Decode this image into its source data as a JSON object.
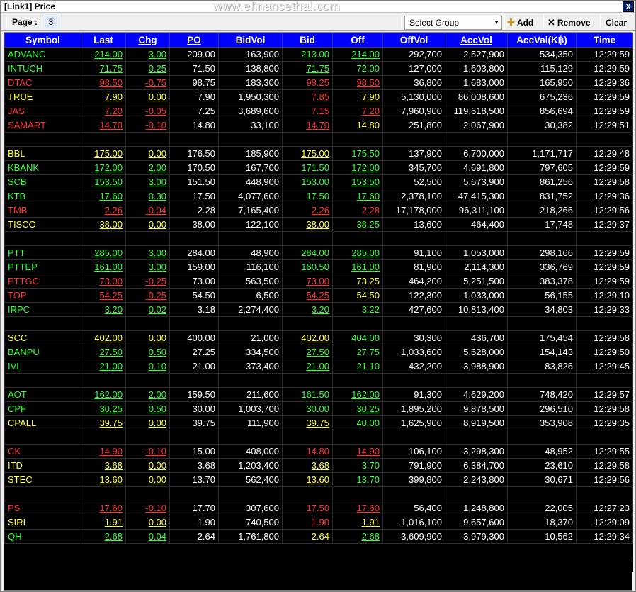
{
  "window": {
    "title": "[Link1] Price",
    "watermark": "www.efinancethai.com",
    "close_label": "X"
  },
  "toolbar": {
    "page_label": "Page :",
    "page_value": "3",
    "group_select": "Select Group",
    "add_label": "Add",
    "remove_label": "Remove",
    "clear_label": "Clear"
  },
  "columns": [
    "Symbol",
    "Last",
    "Chg",
    "PO",
    "BidVol",
    "Bid",
    "Off",
    "OffVol",
    "AccVol",
    "AccVal(K฿)",
    "Time"
  ],
  "colors": {
    "up": "#33ff33",
    "down": "#ff3333",
    "unchanged": "#ffff33",
    "header": "#0000ff"
  },
  "rows": [
    {
      "s": "ADVANC",
      "c": "g",
      "last": "214.00",
      "lc": "g",
      "chg": "3.00",
      "cc": "g",
      "po": "209.00",
      "bidvol": "163,900",
      "bid": "213.00",
      "bc": "g",
      "bu": false,
      "off": "214.00",
      "oc": "g",
      "ou": true,
      "offvol": "292,700",
      "accvol": "2,527,900",
      "accval": "534,350",
      "time": "12:29:59"
    },
    {
      "s": "INTUCH",
      "c": "g",
      "last": "71.75",
      "lc": "g",
      "chg": "0.25",
      "cc": "g",
      "po": "71.50",
      "bidvol": "138,800",
      "bid": "71.75",
      "bc": "g",
      "bu": true,
      "off": "72.00",
      "oc": "g",
      "ou": false,
      "offvol": "127,000",
      "accvol": "1,603,800",
      "accval": "115,129",
      "time": "12:29:59"
    },
    {
      "s": "DTAC",
      "c": "r",
      "last": "98.50",
      "lc": "r",
      "chg": "-0.75",
      "cc": "r",
      "po": "98.75",
      "bidvol": "183,300",
      "bid": "98.25",
      "bc": "r",
      "bu": false,
      "off": "98.50",
      "oc": "r",
      "ou": true,
      "offvol": "36,800",
      "accvol": "1,683,000",
      "accval": "165,950",
      "time": "12:29:36"
    },
    {
      "s": "TRUE",
      "c": "y",
      "last": "7.90",
      "lc": "y",
      "chg": "0.00",
      "cc": "y",
      "po": "7.90",
      "bidvol": "1,950,300",
      "bid": "7.85",
      "bc": "r",
      "bu": false,
      "off": "7.90",
      "oc": "y",
      "ou": true,
      "offvol": "5,130,000",
      "accvol": "86,008,600",
      "accval": "675,236",
      "time": "12:29:59"
    },
    {
      "s": "JAS",
      "c": "r",
      "last": "7.20",
      "lc": "r",
      "chg": "-0.05",
      "cc": "r",
      "po": "7.25",
      "bidvol": "3,689,600",
      "bid": "7.15",
      "bc": "r",
      "bu": false,
      "off": "7.20",
      "oc": "r",
      "ou": true,
      "offvol": "7,960,900",
      "accvol": "119,618,500",
      "accval": "856,694",
      "time": "12:29:59"
    },
    {
      "s": "SAMART",
      "c": "r",
      "last": "14.70",
      "lc": "r",
      "chg": "-0.10",
      "cc": "r",
      "po": "14.80",
      "bidvol": "33,100",
      "bid": "14.70",
      "bc": "r",
      "bu": true,
      "off": "14.80",
      "oc": "y",
      "ou": false,
      "offvol": "251,800",
      "accvol": "2,067,900",
      "accval": "30,382",
      "time": "12:29:51"
    },
    {
      "blank": true
    },
    {
      "s": "BBL",
      "c": "y",
      "last": "175.00",
      "lc": "y",
      "chg": "0.00",
      "cc": "y",
      "po": "176.50",
      "bidvol": "185,900",
      "bid": "175.00",
      "bc": "y",
      "bu": true,
      "off": "175.50",
      "oc": "g",
      "ou": false,
      "offvol": "137,900",
      "accvol": "6,700,000",
      "accval": "1,171,717",
      "time": "12:29:48"
    },
    {
      "s": "KBANK",
      "c": "g",
      "last": "172.00",
      "lc": "g",
      "chg": "2.00",
      "cc": "g",
      "po": "170.50",
      "bidvol": "167,700",
      "bid": "171.50",
      "bc": "g",
      "bu": false,
      "off": "172.00",
      "oc": "g",
      "ou": true,
      "offvol": "345,700",
      "accvol": "4,691,800",
      "accval": "797,605",
      "time": "12:29:59"
    },
    {
      "s": "SCB",
      "c": "g",
      "last": "153.50",
      "lc": "g",
      "chg": "3.00",
      "cc": "g",
      "po": "151.50",
      "bidvol": "448,900",
      "bid": "153.00",
      "bc": "g",
      "bu": false,
      "off": "153.50",
      "oc": "g",
      "ou": true,
      "offvol": "52,500",
      "accvol": "5,673,900",
      "accval": "861,256",
      "time": "12:29:58"
    },
    {
      "s": "KTB",
      "c": "g",
      "last": "17.60",
      "lc": "g",
      "chg": "0.30",
      "cc": "g",
      "po": "17.50",
      "bidvol": "4,077,600",
      "bid": "17.50",
      "bc": "g",
      "bu": false,
      "off": "17.60",
      "oc": "g",
      "ou": true,
      "offvol": "2,378,100",
      "accvol": "47,415,300",
      "accval": "831,752",
      "time": "12:29:36"
    },
    {
      "s": "TMB",
      "c": "r",
      "last": "2.26",
      "lc": "r",
      "chg": "-0.04",
      "cc": "r",
      "po": "2.28",
      "bidvol": "7,165,400",
      "bid": "2.26",
      "bc": "r",
      "bu": true,
      "off": "2.28",
      "oc": "r",
      "ou": false,
      "offvol": "17,178,000",
      "accvol": "96,311,100",
      "accval": "218,266",
      "time": "12:29:56"
    },
    {
      "s": "TISCO",
      "c": "y",
      "last": "38.00",
      "lc": "y",
      "chg": "0.00",
      "cc": "y",
      "po": "38.00",
      "bidvol": "122,100",
      "bid": "38.00",
      "bc": "y",
      "bu": true,
      "off": "38.25",
      "oc": "g",
      "ou": false,
      "offvol": "13,600",
      "accvol": "464,400",
      "accval": "17,748",
      "time": "12:29:37"
    },
    {
      "blank": true
    },
    {
      "s": "PTT",
      "c": "g",
      "last": "285.00",
      "lc": "g",
      "chg": "3.00",
      "cc": "g",
      "po": "284.00",
      "bidvol": "48,900",
      "bid": "284.00",
      "bc": "g",
      "bu": false,
      "off": "285.00",
      "oc": "g",
      "ou": true,
      "offvol": "91,100",
      "accvol": "1,053,000",
      "accval": "298,166",
      "time": "12:29:59"
    },
    {
      "s": "PTTEP",
      "c": "g",
      "last": "161.00",
      "lc": "g",
      "chg": "3.00",
      "cc": "g",
      "po": "159.00",
      "bidvol": "116,100",
      "bid": "160.50",
      "bc": "g",
      "bu": false,
      "off": "161.00",
      "oc": "g",
      "ou": true,
      "offvol": "81,900",
      "accvol": "2,114,300",
      "accval": "336,769",
      "time": "12:29:59"
    },
    {
      "s": "PTTGC",
      "c": "r",
      "last": "73.00",
      "lc": "r",
      "chg": "-0.25",
      "cc": "r",
      "po": "73.00",
      "bidvol": "563,500",
      "bid": "73.00",
      "bc": "r",
      "bu": true,
      "off": "73.25",
      "oc": "y",
      "ou": false,
      "offvol": "464,200",
      "accvol": "5,251,500",
      "accval": "383,378",
      "time": "12:29:59"
    },
    {
      "s": "TOP",
      "c": "r",
      "last": "54.25",
      "lc": "r",
      "chg": "-0.25",
      "cc": "r",
      "po": "54.50",
      "bidvol": "6,500",
      "bid": "54.25",
      "bc": "r",
      "bu": true,
      "off": "54.50",
      "oc": "y",
      "ou": false,
      "offvol": "122,300",
      "accvol": "1,033,000",
      "accval": "56,155",
      "time": "12:29:10"
    },
    {
      "s": "IRPC",
      "c": "g",
      "last": "3.20",
      "lc": "g",
      "chg": "0.02",
      "cc": "g",
      "po": "3.18",
      "bidvol": "2,274,400",
      "bid": "3.20",
      "bc": "g",
      "bu": true,
      "off": "3.22",
      "oc": "g",
      "ou": false,
      "offvol": "427,600",
      "accvol": "10,813,400",
      "accval": "34,803",
      "time": "12:29:33"
    },
    {
      "blank": true
    },
    {
      "s": "SCC",
      "c": "y",
      "last": "402.00",
      "lc": "y",
      "chg": "0.00",
      "cc": "y",
      "po": "400.00",
      "bidvol": "21,000",
      "bid": "402.00",
      "bc": "y",
      "bu": true,
      "off": "404.00",
      "oc": "g",
      "ou": false,
      "offvol": "30,300",
      "accvol": "436,700",
      "accval": "175,454",
      "time": "12:29:58"
    },
    {
      "s": "BANPU",
      "c": "g",
      "last": "27.50",
      "lc": "g",
      "chg": "0.50",
      "cc": "g",
      "po": "27.25",
      "bidvol": "334,500",
      "bid": "27.50",
      "bc": "g",
      "bu": true,
      "off": "27.75",
      "oc": "g",
      "ou": false,
      "offvol": "1,033,600",
      "accvol": "5,628,000",
      "accval": "154,143",
      "time": "12:29:50"
    },
    {
      "s": "IVL",
      "c": "g",
      "last": "21.00",
      "lc": "g",
      "chg": "0.10",
      "cc": "g",
      "po": "21.00",
      "bidvol": "373,400",
      "bid": "21.00",
      "bc": "g",
      "bu": true,
      "off": "21.10",
      "oc": "g",
      "ou": false,
      "offvol": "432,200",
      "accvol": "3,988,900",
      "accval": "83,826",
      "time": "12:29:45"
    },
    {
      "blank": true
    },
    {
      "s": "AOT",
      "c": "g",
      "last": "162.00",
      "lc": "g",
      "chg": "2.00",
      "cc": "g",
      "po": "159.50",
      "bidvol": "211,600",
      "bid": "161.50",
      "bc": "g",
      "bu": false,
      "off": "162.00",
      "oc": "g",
      "ou": true,
      "offvol": "91,300",
      "accvol": "4,629,200",
      "accval": "748,420",
      "time": "12:29:57"
    },
    {
      "s": "CPF",
      "c": "g",
      "last": "30.25",
      "lc": "g",
      "chg": "0.50",
      "cc": "g",
      "po": "30.00",
      "bidvol": "1,003,700",
      "bid": "30.00",
      "bc": "g",
      "bu": false,
      "off": "30.25",
      "oc": "g",
      "ou": true,
      "offvol": "1,895,200",
      "accvol": "9,878,500",
      "accval": "296,510",
      "time": "12:29:58"
    },
    {
      "s": "CPALL",
      "c": "y",
      "last": "39.75",
      "lc": "y",
      "chg": "0.00",
      "cc": "y",
      "po": "39.75",
      "bidvol": "111,900",
      "bid": "39.75",
      "bc": "y",
      "bu": true,
      "off": "40.00",
      "oc": "g",
      "ou": false,
      "offvol": "1,625,900",
      "accvol": "8,919,500",
      "accval": "353,908",
      "time": "12:29:35"
    },
    {
      "blank": true
    },
    {
      "s": "CK",
      "c": "r",
      "last": "14.90",
      "lc": "r",
      "chg": "-0.10",
      "cc": "r",
      "po": "15.00",
      "bidvol": "408,000",
      "bid": "14.80",
      "bc": "r",
      "bu": false,
      "off": "14.90",
      "oc": "r",
      "ou": true,
      "offvol": "106,100",
      "accvol": "3,298,300",
      "accval": "48,952",
      "time": "12:29:55"
    },
    {
      "s": "ITD",
      "c": "y",
      "last": "3.68",
      "lc": "y",
      "chg": "0.00",
      "cc": "y",
      "po": "3.68",
      "bidvol": "1,203,400",
      "bid": "3.68",
      "bc": "y",
      "bu": true,
      "off": "3.70",
      "oc": "g",
      "ou": false,
      "offvol": "791,900",
      "accvol": "6,384,700",
      "accval": "23,610",
      "time": "12:29:58"
    },
    {
      "s": "STEC",
      "c": "y",
      "last": "13.60",
      "lc": "y",
      "chg": "0.00",
      "cc": "y",
      "po": "13.70",
      "bidvol": "562,400",
      "bid": "13.60",
      "bc": "y",
      "bu": true,
      "off": "13.70",
      "oc": "g",
      "ou": false,
      "offvol": "399,800",
      "accvol": "2,243,800",
      "accval": "30,671",
      "time": "12:29:56"
    },
    {
      "blank": true
    },
    {
      "s": "PS",
      "c": "r",
      "last": "17.60",
      "lc": "r",
      "chg": "-0.10",
      "cc": "r",
      "po": "17.70",
      "bidvol": "307,600",
      "bid": "17.50",
      "bc": "r",
      "bu": false,
      "off": "17.60",
      "oc": "r",
      "ou": true,
      "offvol": "56,400",
      "accvol": "1,248,800",
      "accval": "22,005",
      "time": "12:27:23"
    },
    {
      "s": "SIRI",
      "c": "y",
      "last": "1.91",
      "lc": "y",
      "chg": "0.00",
      "cc": "y",
      "po": "1.90",
      "bidvol": "740,500",
      "bid": "1.90",
      "bc": "r",
      "bu": false,
      "off": "1.91",
      "oc": "y",
      "ou": true,
      "offvol": "1,016,100",
      "accvol": "9,657,600",
      "accval": "18,370",
      "time": "12:29:09"
    },
    {
      "s": "QH",
      "c": "g",
      "last": "2.68",
      "lc": "g",
      "chg": "0.04",
      "cc": "g",
      "po": "2.64",
      "bidvol": "1,761,800",
      "bid": "2.64",
      "bc": "y",
      "bu": false,
      "off": "2.68",
      "oc": "g",
      "ou": true,
      "offvol": "3,609,900",
      "accvol": "3,979,300",
      "accval": "10,562",
      "time": "12:29:34"
    }
  ]
}
